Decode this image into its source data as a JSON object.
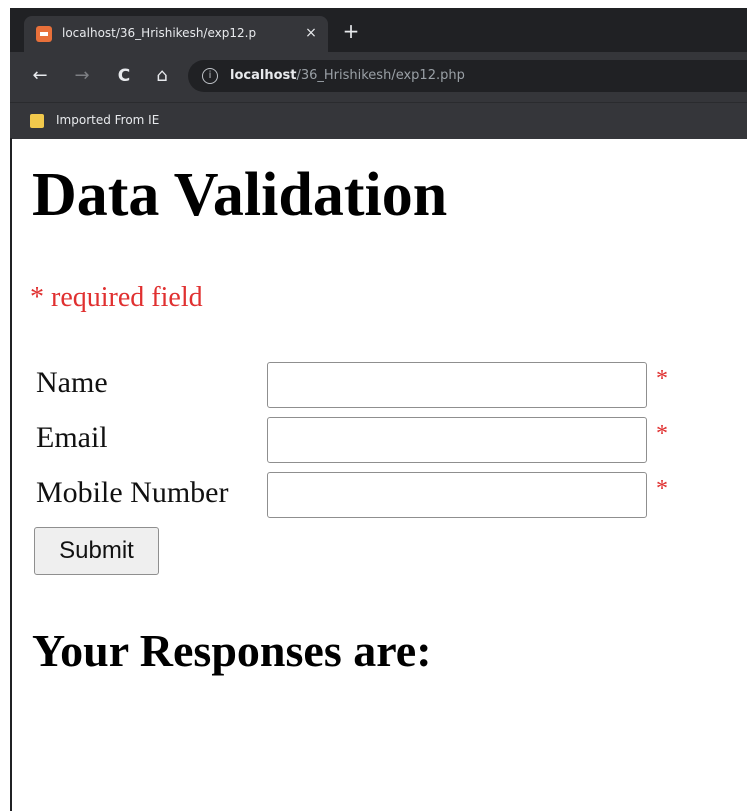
{
  "browser": {
    "tab_title": "localhost/36_Hrishikesh/exp12.p",
    "tab_close": "×",
    "new_tab": "+",
    "back": "←",
    "forward": "→",
    "reload": "C",
    "home": "⌂",
    "info": "i",
    "url_host": "localhost",
    "url_path": "/36_Hrishikesh/exp12.php",
    "bookmark_folder": "Imported From IE"
  },
  "page": {
    "title": "Data Validation",
    "required_note": "* required field",
    "form": {
      "fields": [
        {
          "label": "Name",
          "value": "",
          "required_mark": "*"
        },
        {
          "label": "Email",
          "value": "",
          "required_mark": "*"
        },
        {
          "label": "Mobile Number",
          "value": "",
          "required_mark": "*"
        }
      ],
      "submit_label": "Submit"
    },
    "responses_heading": "Your Responses are:"
  },
  "colors": {
    "chrome_dark": "#202124",
    "chrome_mid": "#35363a",
    "required_red": "#e03030",
    "favicon": "#e8703a"
  }
}
